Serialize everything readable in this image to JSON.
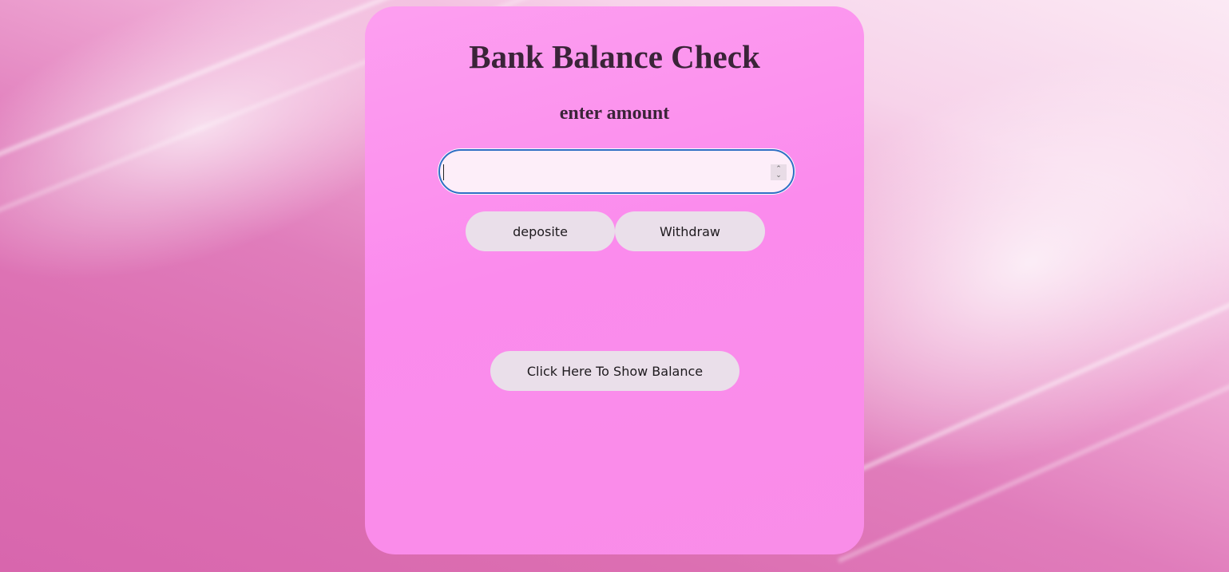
{
  "app": {
    "title": "Bank Balance Check",
    "subtitle": "enter amount"
  },
  "amount_input": {
    "value": "",
    "placeholder": "",
    "type": "number"
  },
  "actions": {
    "deposit_label": "deposite",
    "withdraw_label": "Withdraw",
    "show_balance_label": "Click Here To Show Balance"
  },
  "icons": {
    "spinner_up": "chevron-up-icon",
    "spinner_down": "chevron-down-icon"
  },
  "colors": {
    "card_background": "#fb8bed",
    "button_background": "#eadfea",
    "input_focus_border": "#2f6fc4",
    "text": "#3a2438"
  }
}
